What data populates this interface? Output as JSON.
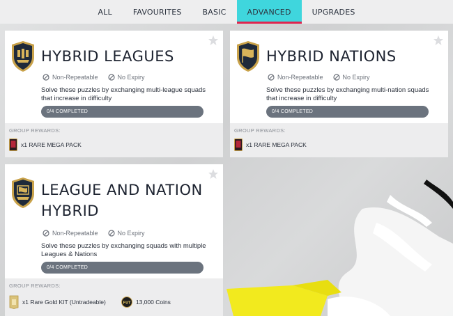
{
  "tabs": [
    {
      "label": "ALL",
      "active": false
    },
    {
      "label": "FAVOURITES",
      "active": false
    },
    {
      "label": "BASIC",
      "active": false
    },
    {
      "label": "ADVANCED",
      "active": true
    },
    {
      "label": "UPGRADES",
      "active": false
    }
  ],
  "cards": [
    {
      "title_line1": "HYBRID LEAGUES",
      "title_line2": "",
      "non_repeatable": "Non-Repeatable",
      "no_expiry": "No Expiry",
      "description": "Solve these puzzles by exchanging multi-league squads that increase in difficulty",
      "progress_label": "0/4 COMPLETED",
      "progress": 0,
      "group_rewards_label": "GROUP REWARDS:",
      "rewards": [
        {
          "label": "x1 RARE MEGA PACK",
          "icon": "rare-mega-pack-icon"
        }
      ]
    },
    {
      "title_line1": "HYBRID NATIONS",
      "title_line2": "",
      "non_repeatable": "Non-Repeatable",
      "no_expiry": "No Expiry",
      "description": "Solve these puzzles by exchanging multi-nation squads that increase in difficulty",
      "progress_label": "0/4 COMPLETED",
      "progress": 0,
      "group_rewards_label": "GROUP REWARDS:",
      "rewards": [
        {
          "label": "x1 RARE MEGA PACK",
          "icon": "rare-mega-pack-icon"
        }
      ]
    },
    {
      "title_line1": "LEAGUE AND NATION",
      "title_line2": "HYBRID",
      "non_repeatable": "Non-Repeatable",
      "no_expiry": "No Expiry",
      "description": "Solve these puzzles by exchanging squads with multiple Leagues & Nations",
      "progress_label": "0/4 COMPLETED",
      "progress": 0,
      "group_rewards_label": "GROUP REWARDS:",
      "rewards": [
        {
          "label": "x1 Rare Gold KIT (Untradeable)",
          "icon": "kit-icon"
        },
        {
          "label": "13,000 Coins",
          "icon": "coin-icon",
          "coin_text": "FUT"
        }
      ]
    }
  ],
  "colors": {
    "active_tab": "#3fd6dd",
    "active_tab_underline": "#e0244e",
    "progress_bar": "#6b737e",
    "badge_gold": "#c9a24a",
    "badge_navy": "#1f2a3a"
  }
}
